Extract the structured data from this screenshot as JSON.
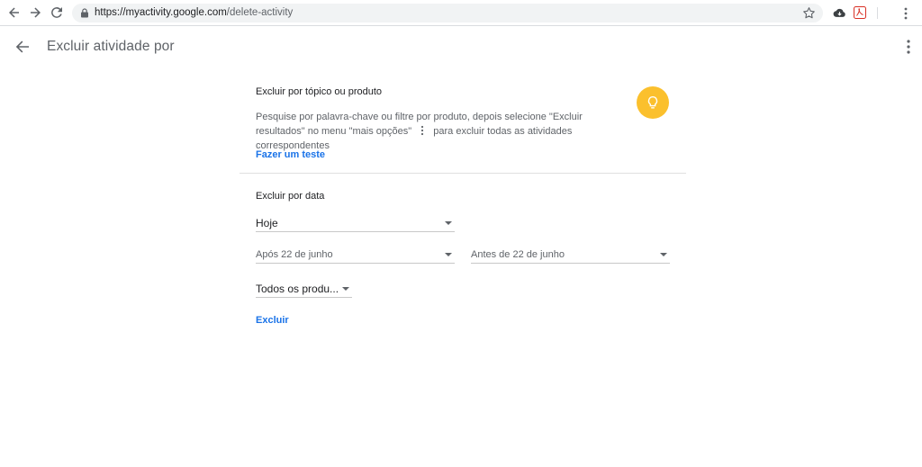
{
  "browser": {
    "url_host": "https://myactivity.google.com",
    "url_path": "/delete-activity"
  },
  "header": {
    "title": "Excluir atividade por"
  },
  "topic_section": {
    "title": "Excluir por tópico ou produto",
    "desc_part1": "Pesquise por palavra-chave ou filtre por produto, depois selecione \"Excluir resultados\" no menu \"mais opções\"",
    "desc_part2": "para excluir todas as atividades correspondentes",
    "try_link": "Fazer um teste"
  },
  "date_section": {
    "title": "Excluir por data",
    "range_select": "Hoje",
    "after_select": "Após 22 de junho",
    "before_select": "Antes de 22 de junho",
    "product_select": "Todos os produ...",
    "delete_link": "Excluir"
  },
  "colors": {
    "accent": "#1a73e8",
    "bulb": "#fbc02d"
  }
}
